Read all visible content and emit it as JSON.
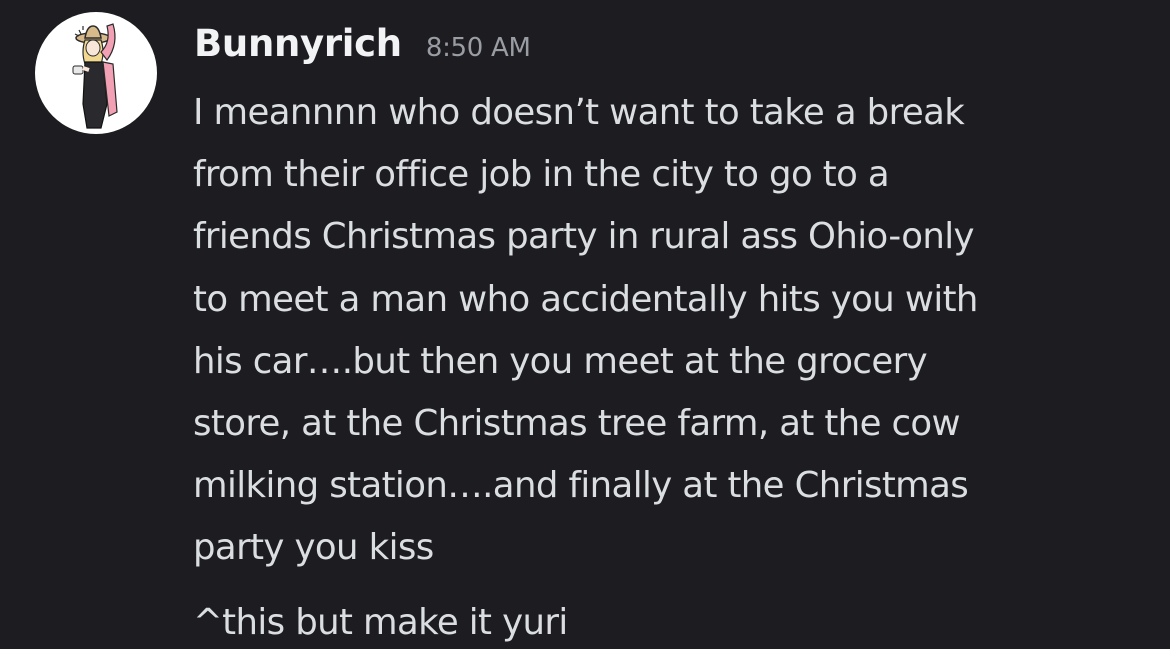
{
  "message": {
    "author": "Bunnyrich",
    "timestamp": "8:50 AM",
    "avatar_icon": "user-avatar-icon",
    "lines": [
      "I meannnn who doesn’t want to take a break",
      "from their office job in the city to go to a",
      "friends Christmas party in rural ass Ohio-only",
      "to meet a man who accidentally hits you with",
      "his car….but then you meet at the grocery",
      "store, at the Christmas tree farm, at the cow",
      "milking station….and finally at the Christmas",
      "party you kiss"
    ],
    "followup": "^this but make it yuri"
  },
  "colors": {
    "background": "#1c1c21",
    "username": "#f2f3f5",
    "timestamp": "#9a9ca3",
    "text": "#dbdee1"
  }
}
